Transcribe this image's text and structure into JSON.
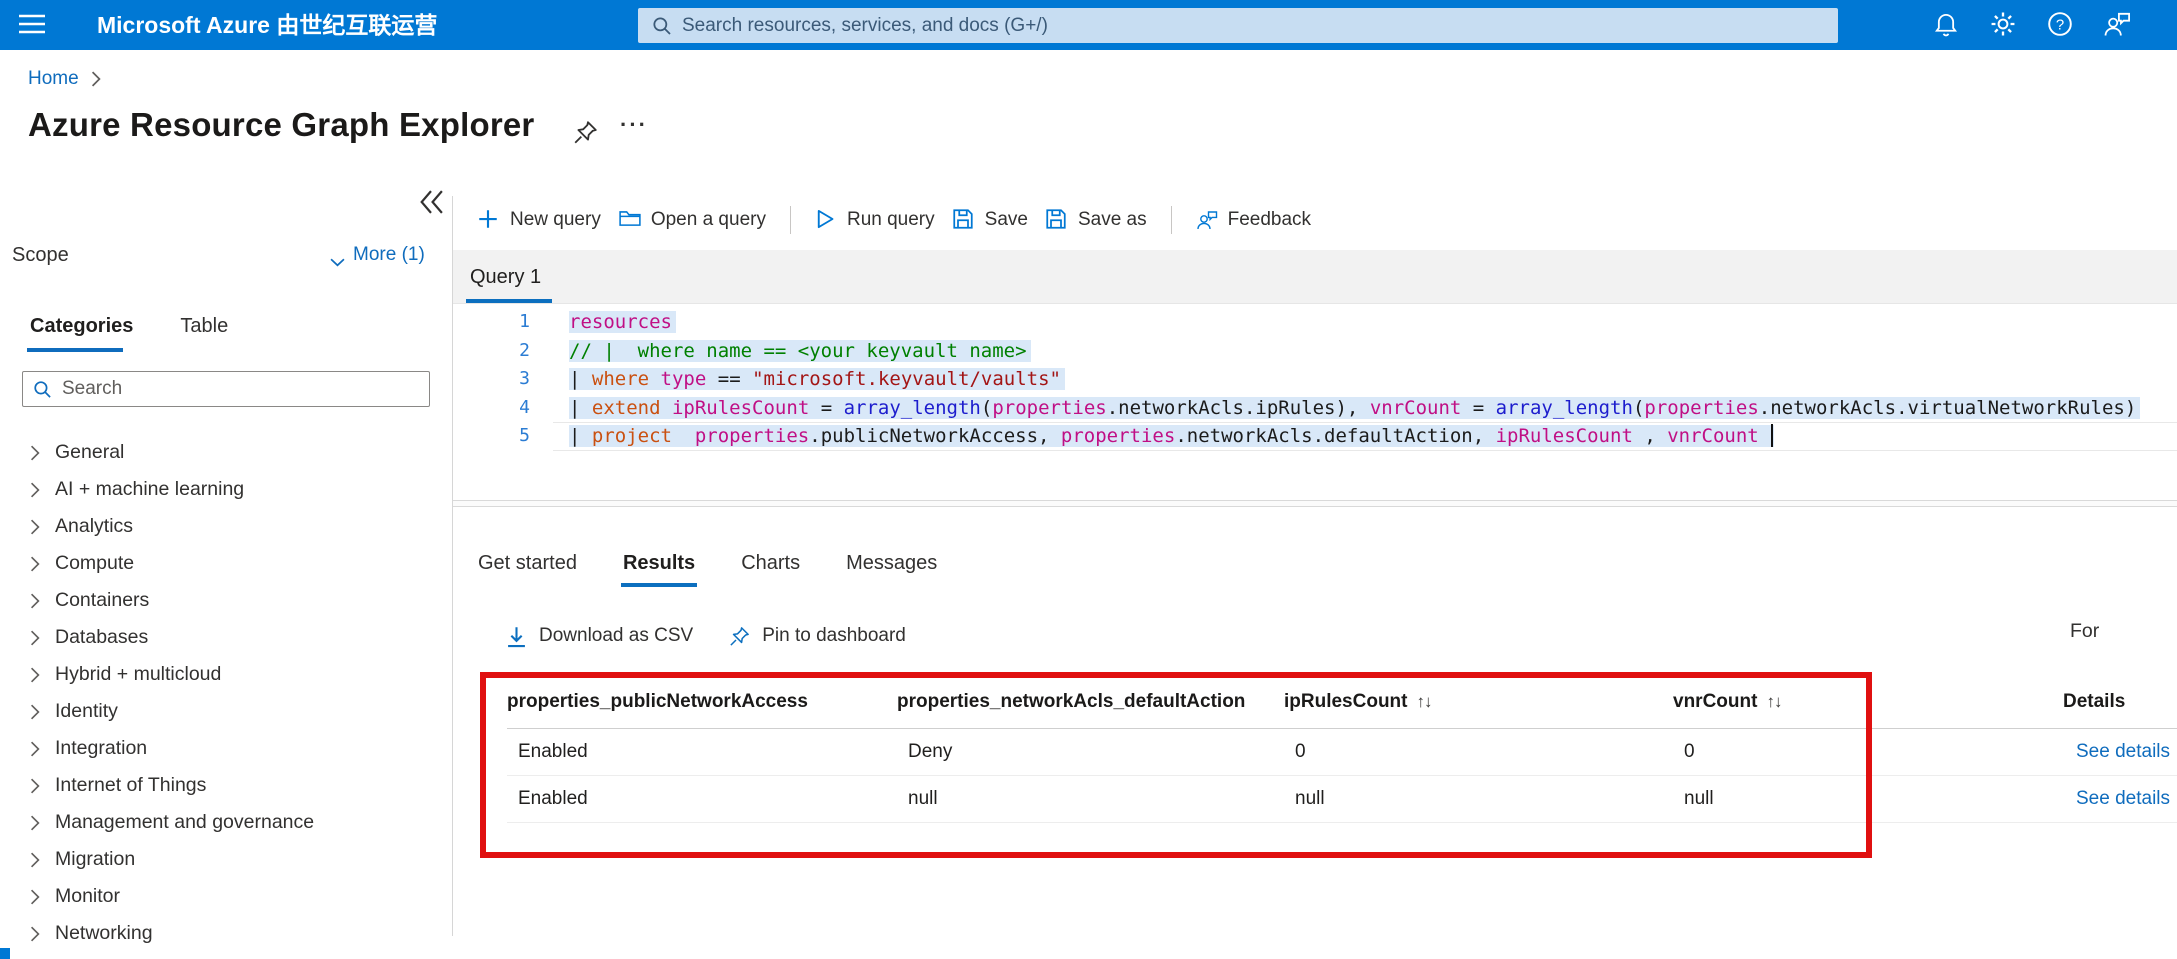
{
  "topbar": {
    "brand": "Microsoft Azure 由世纪互联运营",
    "search_placeholder": "Search resources, services, and docs (G+/)"
  },
  "breadcrumb": {
    "home": "Home"
  },
  "page": {
    "title": "Azure Resource Graph Explorer",
    "more_dots": "···"
  },
  "sidebar": {
    "scope_label": "Scope",
    "more_label": "More (1)",
    "tab_categories": "Categories",
    "tab_table": "Table",
    "search_placeholder": "Search",
    "categories": [
      "General",
      "AI + machine learning",
      "Analytics",
      "Compute",
      "Containers",
      "Databases",
      "Hybrid + multicloud",
      "Identity",
      "Integration",
      "Internet of Things",
      "Management and governance",
      "Migration",
      "Monitor",
      "Networking"
    ]
  },
  "command_bar": {
    "items": [
      {
        "label": "New query",
        "icon": "plus-icon"
      },
      {
        "label": "Open a query",
        "icon": "folder-open-icon"
      },
      {
        "divider": true
      },
      {
        "label": "Run query",
        "icon": "run-play-icon"
      },
      {
        "label": "Save",
        "icon": "save-icon"
      },
      {
        "label": "Save as",
        "icon": "save-as-icon"
      },
      {
        "divider": true
      },
      {
        "label": "Feedback",
        "icon": "feedback-icon"
      }
    ]
  },
  "editor": {
    "tab_label": "Query 1",
    "lines": [
      {
        "num": "1",
        "selected": true,
        "tokens": [
          [
            "id",
            "resources"
          ]
        ]
      },
      {
        "num": "2",
        "selected": true,
        "tokens": [
          [
            "cm",
            "// |  where name == <your keyvault name>"
          ]
        ]
      },
      {
        "num": "3",
        "selected": true,
        "tokens": [
          [
            "tx",
            "| "
          ],
          [
            "kw",
            "where"
          ],
          [
            "tx",
            " "
          ],
          [
            "id",
            "type"
          ],
          [
            "tx",
            " "
          ],
          [
            "op",
            "=="
          ],
          [
            "tx",
            " "
          ],
          [
            "st",
            "\"microsoft.keyvault/vaults\""
          ]
        ]
      },
      {
        "num": "4",
        "selected": true,
        "tokens": [
          [
            "tx",
            "| "
          ],
          [
            "kw",
            "extend"
          ],
          [
            "tx",
            " "
          ],
          [
            "id",
            "ipRulesCount"
          ],
          [
            "tx",
            " = "
          ],
          [
            "fn",
            "array_length"
          ],
          [
            "tx",
            "("
          ],
          [
            "id",
            "properties"
          ],
          [
            "tx",
            ".networkAcls.ipRules), "
          ],
          [
            "id",
            "vnrCount"
          ],
          [
            "tx",
            " = "
          ],
          [
            "fn",
            "array_length"
          ],
          [
            "tx",
            "("
          ],
          [
            "id",
            "properties"
          ],
          [
            "tx",
            ".networkAcls.virtualNetworkRules)"
          ]
        ]
      },
      {
        "num": "5",
        "selected": true,
        "cursor": true,
        "current": true,
        "tokens": [
          [
            "tx",
            "| "
          ],
          [
            "kw",
            "project"
          ],
          [
            "tx",
            "  "
          ],
          [
            "id",
            "properties"
          ],
          [
            "tx",
            ".publicNetworkAccess, "
          ],
          [
            "id",
            "properties"
          ],
          [
            "tx",
            ".networkAcls.defaultAction, "
          ],
          [
            "id",
            "ipRulesCount"
          ],
          [
            "tx",
            " , "
          ],
          [
            "id",
            "vnrCount"
          ],
          [
            "tx",
            " "
          ]
        ]
      }
    ]
  },
  "results": {
    "tabs": [
      {
        "label": "Get started",
        "active": false
      },
      {
        "label": "Results",
        "active": true
      },
      {
        "label": "Charts",
        "active": false
      },
      {
        "label": "Messages",
        "active": false
      }
    ],
    "actions": [
      {
        "label": "Download as CSV",
        "icon": "download-icon"
      },
      {
        "label": "Pin to dashboard",
        "icon": "pin-icon"
      }
    ],
    "corner_label": "For",
    "table": {
      "columns": [
        {
          "label": "properties_publicNetworkAccess",
          "sortable": false
        },
        {
          "label": "properties_networkAcls_defaultAction",
          "sortable": false
        },
        {
          "label": "ipRulesCount",
          "sortable": true
        },
        {
          "label": "vnrCount",
          "sortable": true
        },
        {
          "label": "Details",
          "sortable": false
        }
      ],
      "sort_glyph": "↑↓",
      "rows": [
        {
          "cells": [
            "Enabled",
            "Deny",
            "0",
            "0"
          ],
          "details": "See details"
        },
        {
          "cells": [
            "Enabled",
            "null",
            "null",
            "null"
          ],
          "details": "See details"
        }
      ]
    }
  },
  "icons": {
    "hamburger-icon": "☰",
    "search-icon": "⌕",
    "notifications-bell-icon": "🔔",
    "settings-gear-icon": "⚙",
    "help-icon": "?",
    "feedback-icon": "👤💬",
    "chevron-right-icon": "›",
    "chevron-down-icon": "∨",
    "collapse-double-chevron-icon": "«",
    "pin-icon": "📌",
    "plus-icon": "+",
    "folder-open-icon": "🗀",
    "run-play-icon": "▷",
    "save-icon": "💾",
    "save-as-icon": "💾",
    "download-icon": "↓",
    "sort-icon": "↑↓"
  },
  "colors": {
    "accent": "#0078d4",
    "link": "#0f6cbd",
    "highlight_box": "#e01010",
    "code_keyword": "#ca5010",
    "code_identifier": "#c00f85",
    "code_function": "#1d1dcd",
    "code_string": "#a31515",
    "code_comment": "#008000",
    "selection": "#d9e8f8"
  }
}
